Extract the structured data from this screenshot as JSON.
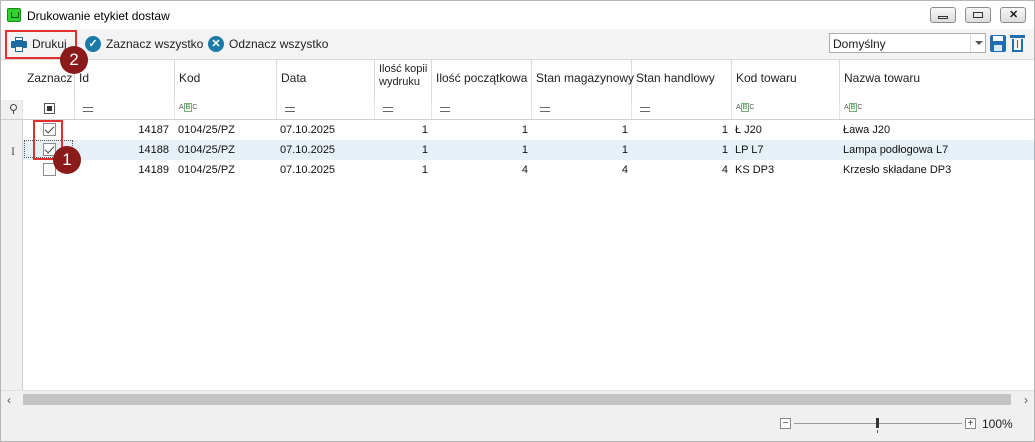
{
  "window": {
    "title": "Drukowanie etykiet dostaw"
  },
  "toolbar": {
    "print_label": "Drukuj",
    "select_all_label": "Zaznacz wszystko",
    "deselect_all_label": "Odznacz wszystko",
    "profile_value": "Domyślny"
  },
  "columns": {
    "zaznacz": "Zaznacz",
    "id": "Id",
    "kod": "Kod",
    "data": "Data",
    "ilosc_kopii_line1": "Ilość kopii",
    "ilosc_kopii_line2": "wydruku",
    "ilosc_poczatkowa": "Ilość początkowa",
    "stan_magazynowy": "Stan magazynowy",
    "stan_handlowy": "Stan handlowy",
    "kod_towaru": "Kod towaru",
    "nazwa_towaru": "Nazwa towaru"
  },
  "filter_icons": {
    "text": "ABC"
  },
  "rows": [
    {
      "checked": true,
      "id": "14187",
      "kod": "0104/25/PZ",
      "data": "07.10.2025",
      "kopie": "1",
      "poczatkowa": "1",
      "magazynowy": "1",
      "handlowy": "1",
      "kod_towaru": "Ł J20",
      "nazwa": "Ława J20"
    },
    {
      "checked": true,
      "id": "14188",
      "kod": "0104/25/PZ",
      "data": "07.10.2025",
      "kopie": "1",
      "poczatkowa": "1",
      "magazynowy": "1",
      "handlowy": "1",
      "kod_towaru": "LP L7",
      "nazwa": "Lampa podłogowa L7"
    },
    {
      "checked": false,
      "id": "14189",
      "kod": "0104/25/PZ",
      "data": "07.10.2025",
      "kopie": "1",
      "poczatkowa": "4",
      "magazynowy": "4",
      "handlowy": "4",
      "kod_towaru": "KS DP3",
      "nazwa": "Krzesło składane DP3"
    }
  ],
  "annotations": {
    "badge1": "1",
    "badge2": "2"
  },
  "zoom": {
    "label": "100%",
    "minus": "−",
    "plus": "+"
  },
  "scroll": {
    "left": "‹",
    "right": "›"
  },
  "colors": {
    "accent": "#1b7aa8",
    "highlight": "#e03030",
    "badge": "#8b1a1a",
    "selected_row": "#e6f0f8"
  }
}
